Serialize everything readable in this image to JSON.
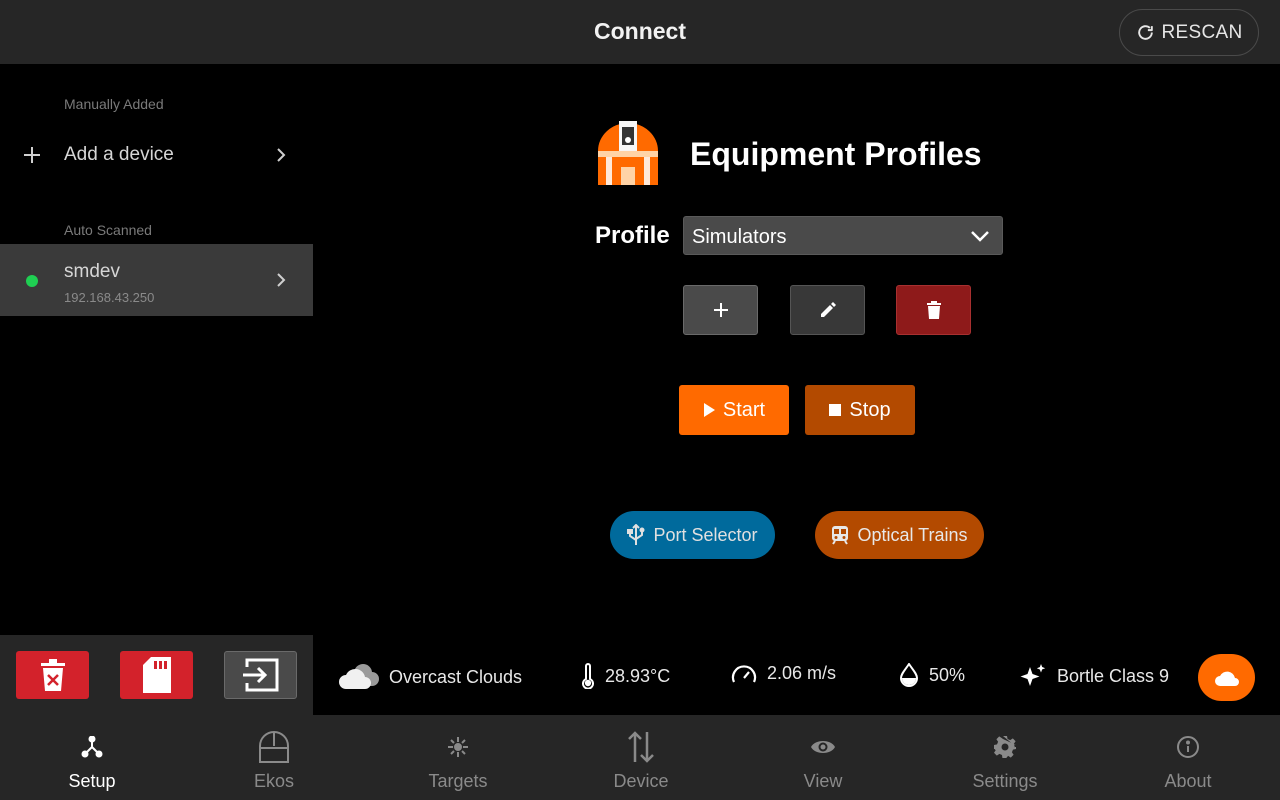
{
  "header": {
    "title": "Connect",
    "rescan_label": "RESCAN"
  },
  "sidebar": {
    "manual_section": "Manually Added",
    "add_device_label": "Add a device",
    "auto_section": "Auto Scanned",
    "devices": [
      {
        "name": "smdev",
        "ip": "192.168.43.250",
        "status_color": "#1fcf52"
      }
    ]
  },
  "main": {
    "title": "Equipment Profiles",
    "profile_label": "Profile",
    "profile_selected": "Simulators",
    "start_label": "Start",
    "stop_label": "Stop",
    "port_selector_label": "Port Selector",
    "optical_trains_label": "Optical Trains"
  },
  "weather": {
    "condition": "Overcast Clouds",
    "temperature": "28.93°C",
    "wind": "2.06 m/s",
    "humidity": "50%",
    "bortle": "Bortle Class 9"
  },
  "nav": {
    "items": [
      {
        "label": "Setup",
        "icon": "setup-icon"
      },
      {
        "label": "Ekos",
        "icon": "observatory-icon"
      },
      {
        "label": "Targets",
        "icon": "targets-icon"
      },
      {
        "label": "Device",
        "icon": "device-arrows-icon"
      },
      {
        "label": "View",
        "icon": "eye-icon"
      },
      {
        "label": "Settings",
        "icon": "gear-icon"
      },
      {
        "label": "About",
        "icon": "info-icon"
      }
    ]
  },
  "colors": {
    "accent": "#ff6a00",
    "danger": "#d3222b",
    "port_blue": "#006a9c",
    "stop_orange": "#b34a00"
  }
}
